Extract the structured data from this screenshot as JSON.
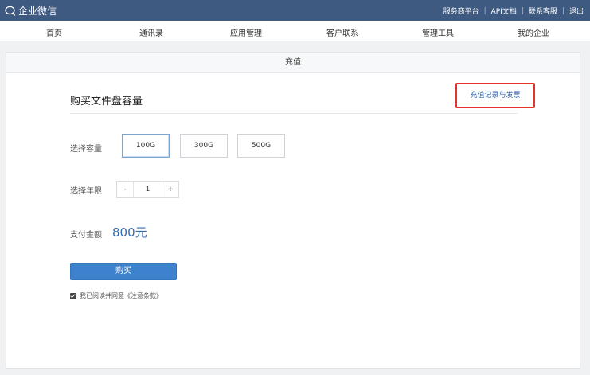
{
  "topbar": {
    "brand": "企业微信",
    "links": [
      "服务商平台",
      "API文档",
      "联系客服",
      "退出"
    ]
  },
  "nav": {
    "items": [
      "首页",
      "通讯录",
      "应用管理",
      "客户联系",
      "管理工具",
      "我的企业"
    ]
  },
  "panel": {
    "header": "充值",
    "title": "购买文件盘容量",
    "record_link": "充值记录与发票",
    "capacity_label": "选择容量",
    "capacity_options": [
      "100G",
      "300G",
      "500G"
    ],
    "capacity_selected": "100G",
    "years_label": "选择年限",
    "years_minus": "-",
    "years_value": "1",
    "years_plus": "+",
    "amount_label": "支付金额",
    "amount_value": "800元",
    "buy_label": "购买",
    "agree_text": "我已阅读并同意《注意条款》",
    "agree_checked": true
  },
  "colors": {
    "topbar": "#3f5a80",
    "accent": "#3d82cc",
    "highlight_border": "#e5322d"
  }
}
